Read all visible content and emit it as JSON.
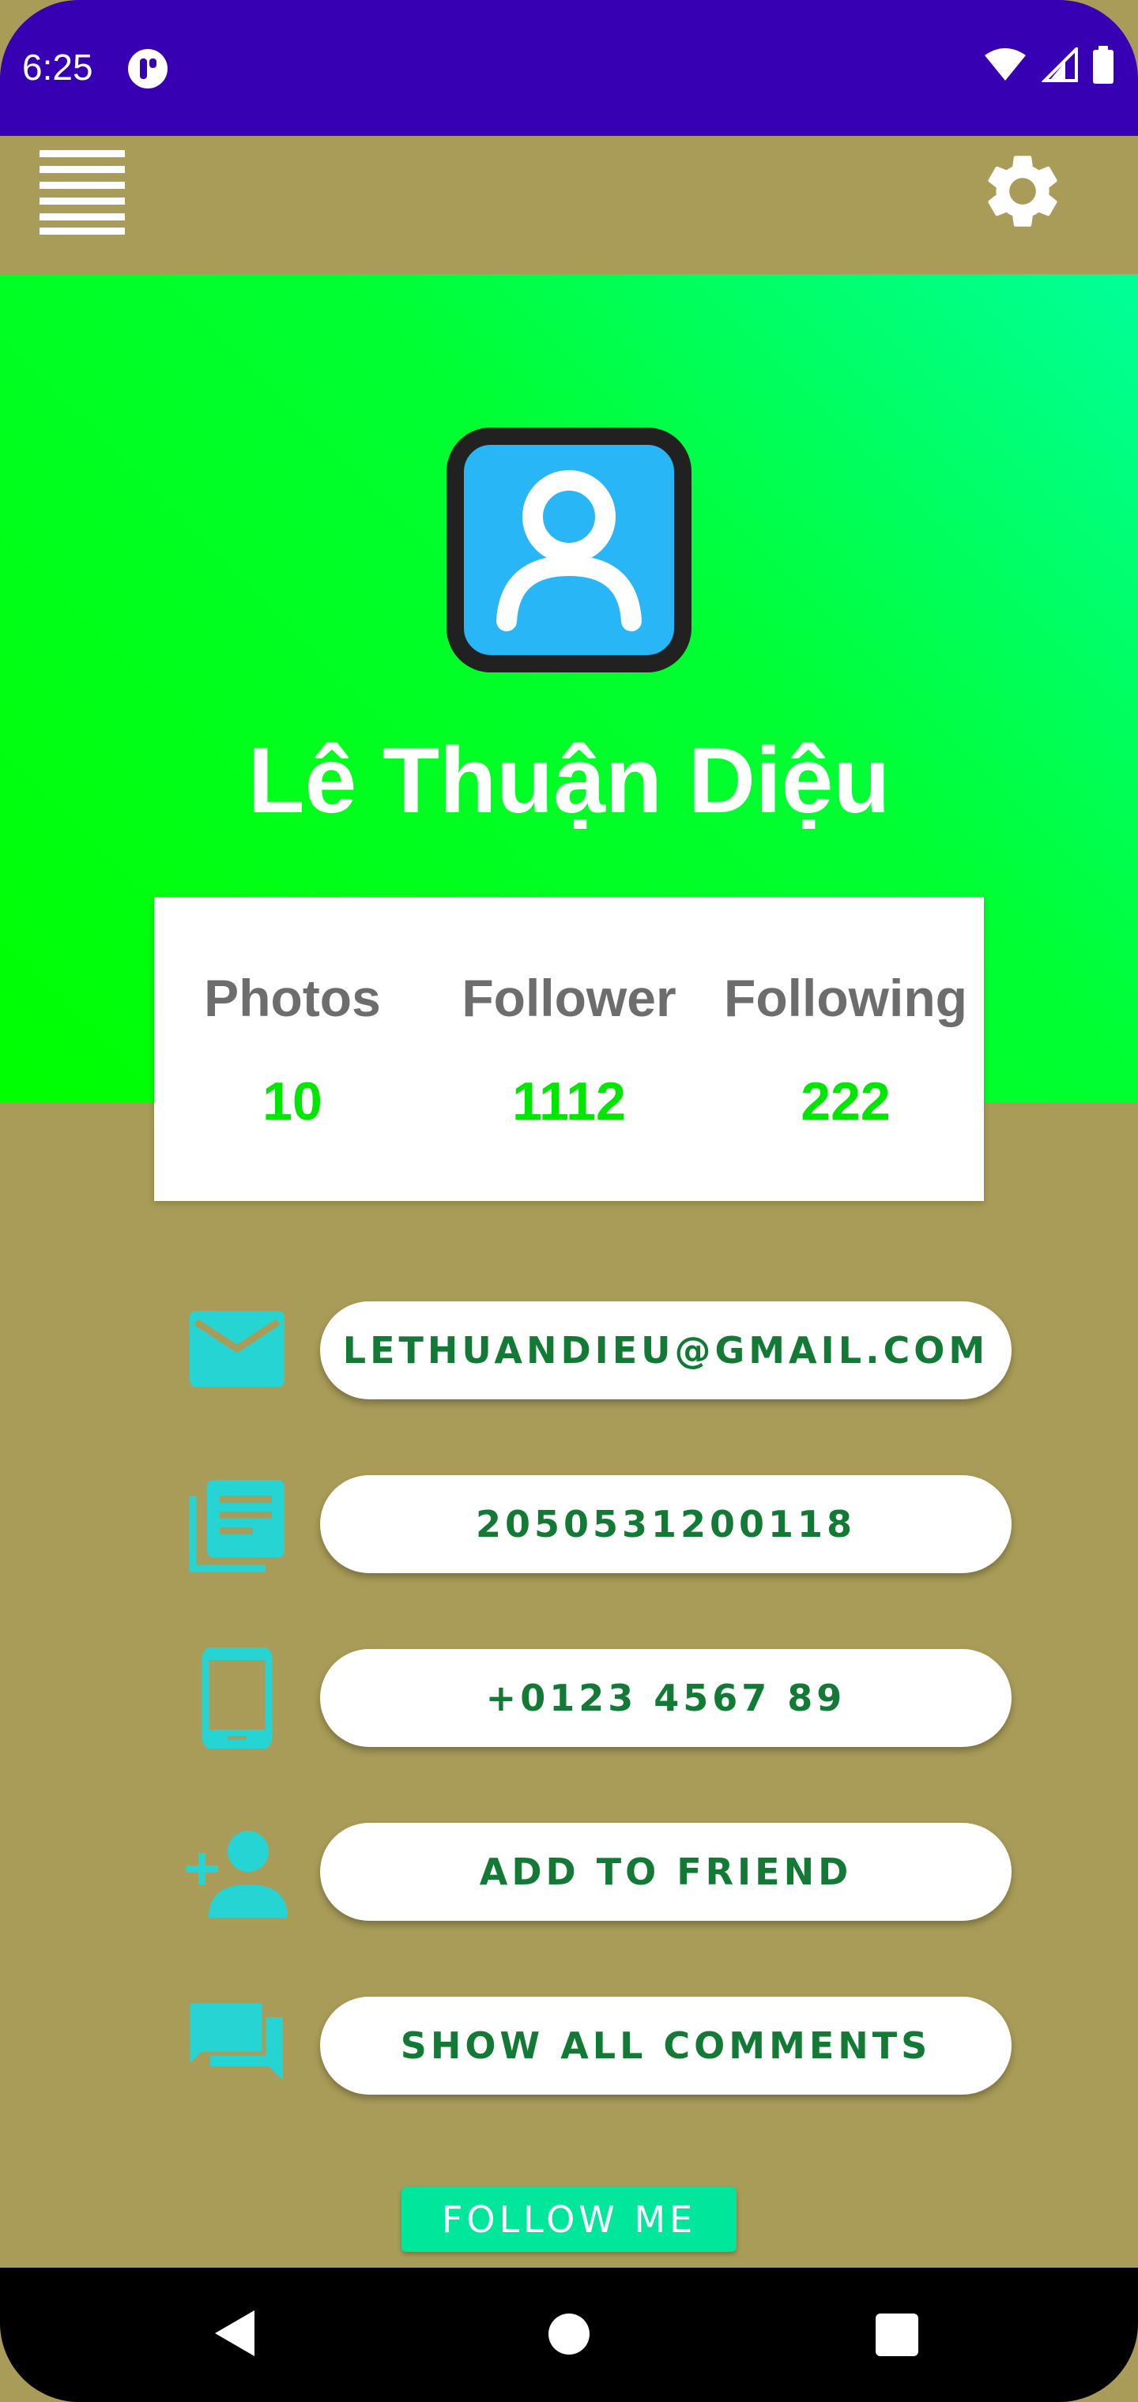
{
  "status_bar": {
    "time": "6:25"
  },
  "profile": {
    "name": "Lê Thuận Diệu"
  },
  "stats": [
    {
      "label": "Photos",
      "value": "10"
    },
    {
      "label": "Follower",
      "value": "1112"
    },
    {
      "label": "Following",
      "value": "222"
    }
  ],
  "actions": {
    "email": "LETHUANDIEU@GMAIL.COM",
    "id": "2050531200118",
    "phone": "+0123 4567 89",
    "add_friend": "ADD TO FRIEND",
    "comments": "SHOW ALL COMMENTS"
  },
  "follow_button": "FOLLOW ME",
  "colors": {
    "status_bar": "#3700b3",
    "background": "#a99c58",
    "hero_gradient_start": "#00ff00",
    "hero_gradient_end": "#00ff99",
    "stat_value": "#00e600",
    "pill_text": "#137a35",
    "icon_teal": "#26d4d4",
    "follow_button": "#00e69a"
  },
  "icons": [
    "menu-icon",
    "gear-icon",
    "avatar-person-icon",
    "email-icon",
    "document-icon",
    "phone-icon",
    "add-person-icon",
    "comments-icon"
  ]
}
